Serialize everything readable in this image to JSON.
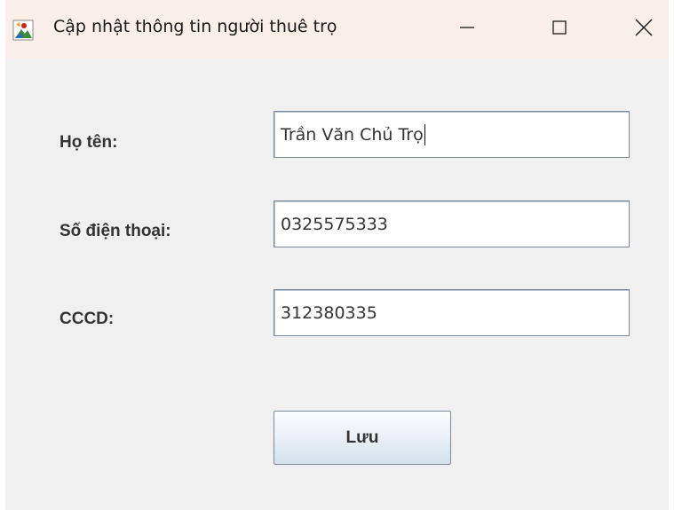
{
  "window": {
    "title": "Cập nhật thông tin người thuê trọ",
    "icons": {
      "app": "java-app-icon",
      "minimize": "minimize-icon",
      "maximize": "maximize-icon",
      "close": "close-icon"
    }
  },
  "form": {
    "name_label": "Họ tên:",
    "name_value": "Trần Văn Chủ Trọ",
    "phone_label": "Số điện thoại:",
    "phone_value": "0325575333",
    "id_label": "CCCD:",
    "id_value": "312380335",
    "save_label": "Lưu"
  },
  "colors": {
    "titlebar": "#f9efe8",
    "window_bg": "#f0f0f0",
    "label_text": "#333333",
    "field_border": "#7a8a9a",
    "button_gradient_bottom": "#d4e0ec"
  }
}
